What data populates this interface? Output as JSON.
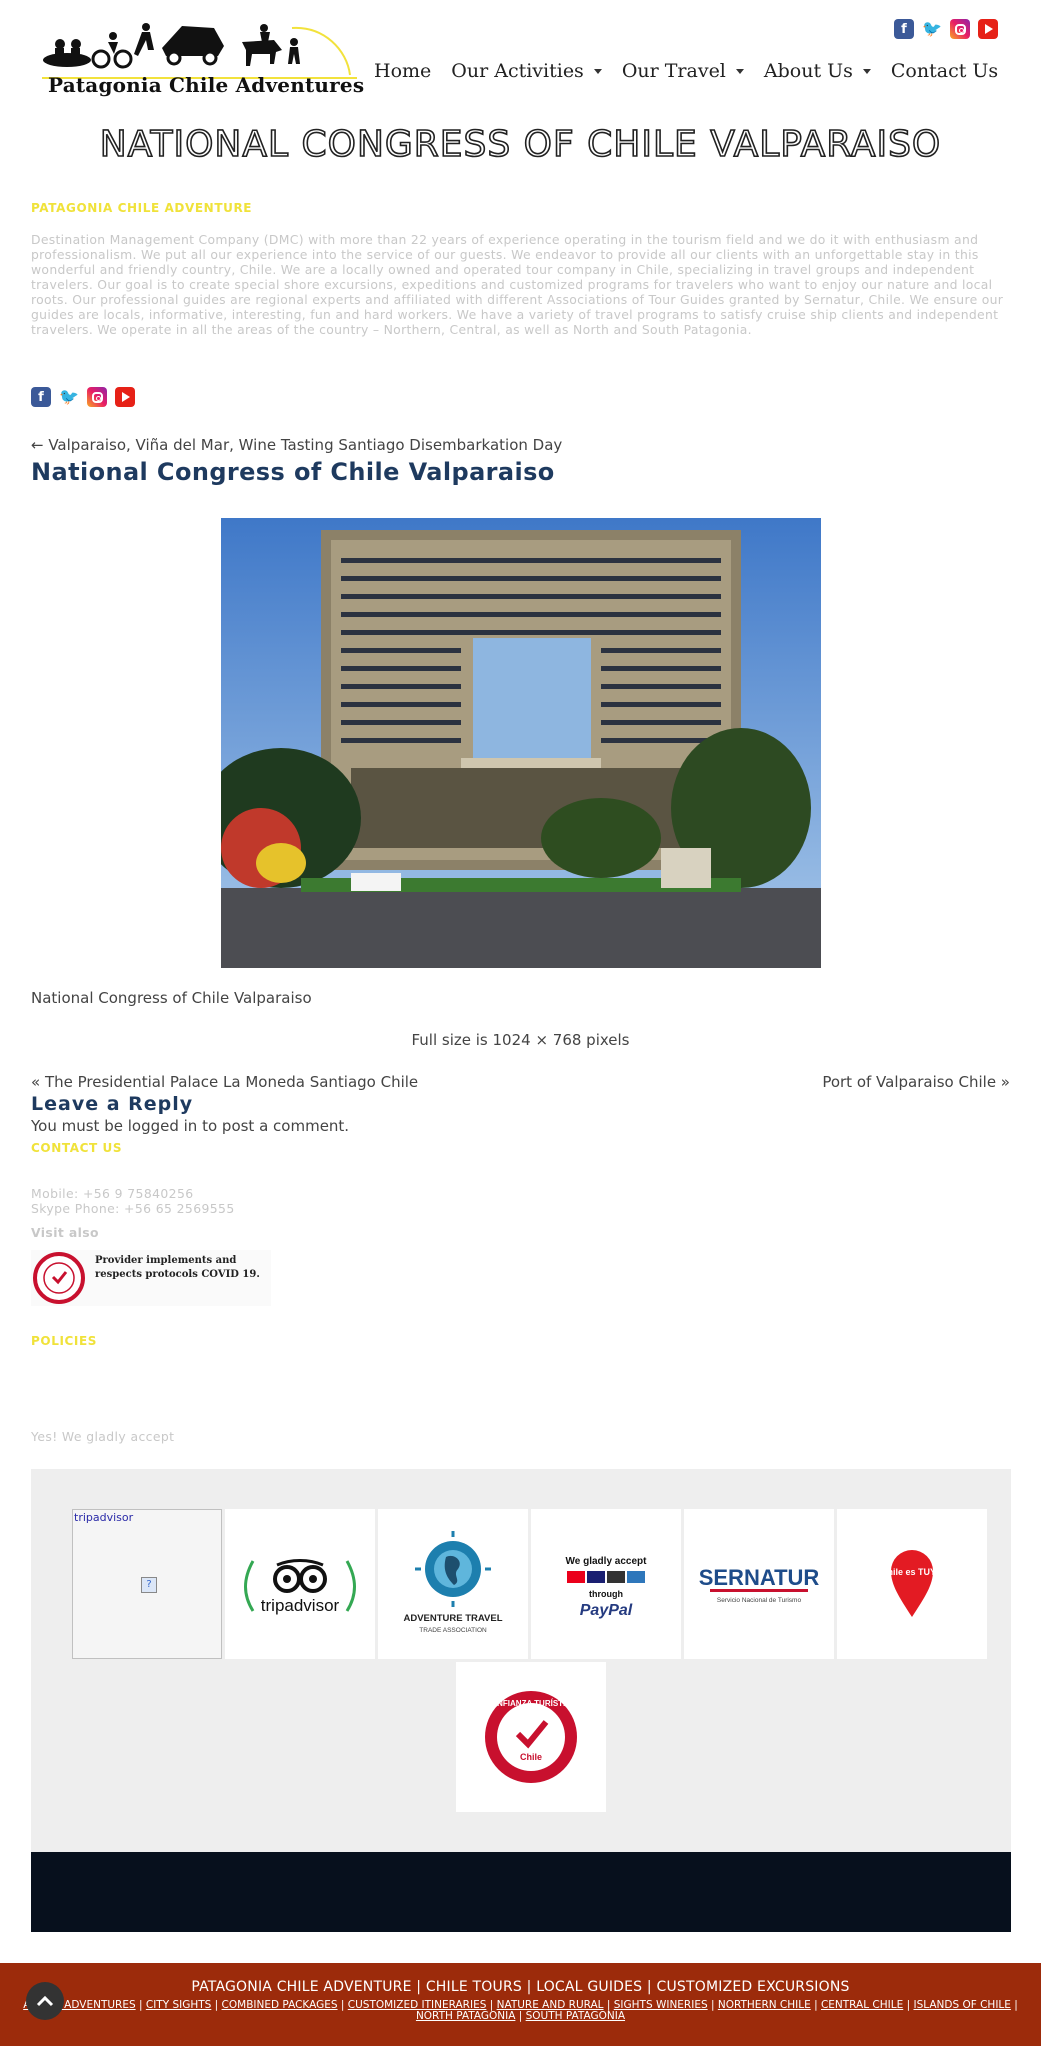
{
  "header": {
    "logo_text": "Patagonia Chile Adventures",
    "social": [
      "facebook-icon",
      "twitter-icon",
      "instagram-icon",
      "youtube-icon"
    ],
    "nav": [
      {
        "label": "Home",
        "dropdown": false
      },
      {
        "label": "Our Activities",
        "dropdown": true
      },
      {
        "label": "Our Travel",
        "dropdown": true
      },
      {
        "label": "About Us",
        "dropdown": true
      },
      {
        "label": "Contact Us",
        "dropdown": false
      }
    ]
  },
  "hero": {
    "title": "NATIONAL CONGRESS OF CHILE VALPARAISO"
  },
  "about": {
    "heading": "PATAGONIA CHILE ADVENTURE",
    "text": "Destination Management Company (DMC) with more than 22 years of experience operating in the tourism field and we do it with enthusiasm and professionalism. We put all our experience into the service of our guests. We endeavor to provide all our clients with an unforgettable stay in this wonderful and friendly country, Chile. We are a locally owned and operated tour company in Chile, specializing in travel groups and independent travelers. Our goal is to create special shore excursions, expeditions and customized programs for travelers who want to enjoy our nature and local roots. Our professional guides are regional experts and affiliated with different Associations of Tour Guides granted by Sernatur, Chile. We ensure our guides are locals, informative, interesting, fun and hard workers. We have a variety of travel programs to satisfy cruise ship clients and independent travelers. We operate in all the areas of the country – Northern, Central, as well as North and South Patagonia."
  },
  "post": {
    "breadcrumb": "← Valparaiso, Viña del Mar, Wine Tasting Santiago Disembarkation Day",
    "title": "National Congress of Chile Valparaiso",
    "caption": "National Congress of Chile Valparaiso",
    "fullsize": "Full size is 1024 × 768 pixels",
    "prev": "« The Presidential Palace La Moneda Santiago Chile",
    "next": "Port of Valparaiso Chile »"
  },
  "reply": {
    "heading": "Leave a Reply",
    "note_before": "You must be ",
    "note_link": "logged in",
    "note_after": " to post a comment."
  },
  "contact": {
    "heading": "CONTACT US",
    "mobile": "Mobile: +56 9 75840256",
    "skype": "Skype Phone: +56 65 2569555",
    "visit": "Visit also",
    "covid_text": "Provider implements and respects protocols COVID 19."
  },
  "policies": {
    "heading": "POLICIES",
    "accept": "Yes! We gladly accept"
  },
  "partners": {
    "broken_alt": "tripadvisor",
    "tripadvisor": "tripadvisor",
    "att_line1": "ADVENTURE TRAVEL",
    "att_line2": "TRADE ASSOCIATION",
    "paypal_top": "We gladly accept",
    "paypal_mid": "through",
    "paypal_brand": "PayPal",
    "sernatur": "SERNATUR",
    "sernatur_sub": "Servicio Nacional de Turismo",
    "chile_pin": "Chile es TUYO",
    "confianza": "CONFIANZA TURÍSTICA",
    "confianza_chile": "Chile"
  },
  "footer": {
    "title": "PATAGONIA CHILE ADVENTURE | CHILE TOURS | LOCAL GUIDES | CUSTOMIZED EXCURSIONS",
    "links": [
      "ACTIVE ADVENTURES",
      "CITY SIGHTS",
      "COMBINED PACKAGES",
      "CUSTOMIZED ITINERARIES",
      "NATURE AND RURAL",
      "SIGHTS WINERIES",
      "NORTHERN CHILE",
      "CENTRAL CHILE",
      "ISLANDS OF CHILE",
      "NORTH PATAGONIA",
      "SOUTH PATAGONIA"
    ]
  }
}
